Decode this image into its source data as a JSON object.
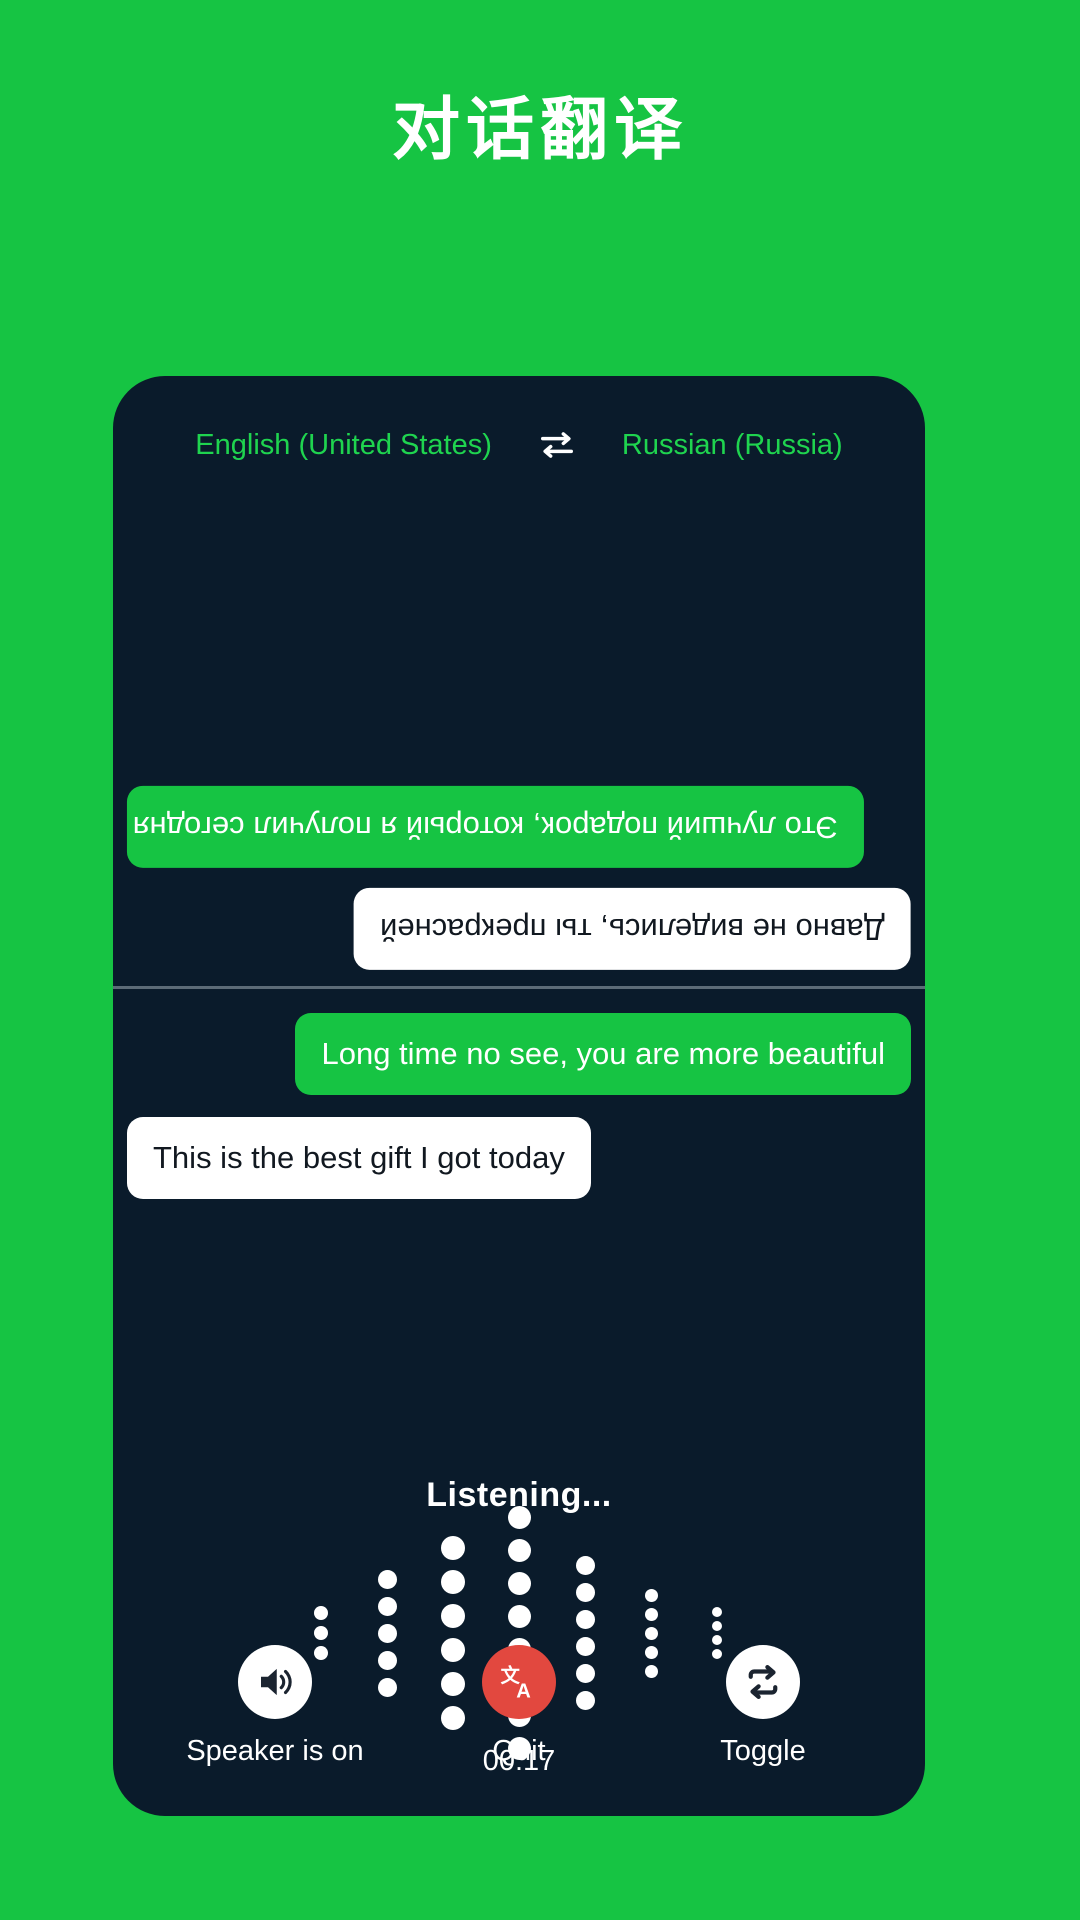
{
  "header": {
    "title": "对话翻译"
  },
  "colors": {
    "brand_green": "#16C443",
    "panel_dark": "#0A1B2B",
    "accent_green_text": "#1FD44F",
    "quit_red": "#E2483F",
    "bubble_white": "#FFFFFF",
    "divider": "#5C6B77"
  },
  "language_bar": {
    "source_language": "English (United States)",
    "swap_icon": "swap-horizontal-icon",
    "target_language": "Russian (Russia)"
  },
  "conversation": {
    "top_panel": {
      "orientation": "rotated-180",
      "messages": [
        {
          "text": "Это лучший подарок, который я получил сегодня",
          "style": "green",
          "align": "left"
        },
        {
          "text": "Давно не виделись, ты прекрасней",
          "style": "white",
          "align": "right"
        }
      ]
    },
    "bottom_panel": {
      "orientation": "normal",
      "messages": [
        {
          "text": "Long time no see, you are more beautiful",
          "style": "green",
          "align": "right"
        },
        {
          "text": "This is the best gift I got today",
          "style": "white",
          "align": "left"
        }
      ]
    }
  },
  "listening": {
    "status_text": "Listening...",
    "timer": "00:17",
    "waveform": {
      "columns": [
        {
          "dots": 3,
          "size": 14
        },
        {
          "dots": 5,
          "size": 19
        },
        {
          "dots": 6,
          "size": 24
        },
        {
          "dots": 8,
          "size": 23
        },
        {
          "dots": 6,
          "size": 19
        },
        {
          "dots": 5,
          "size": 13
        },
        {
          "dots": 4,
          "size": 10
        }
      ]
    }
  },
  "controls": [
    {
      "label": "Speaker is on",
      "icon": "speaker-on-icon",
      "circle": "white"
    },
    {
      "label": "Quit",
      "icon": "translate-icon",
      "circle": "red"
    },
    {
      "label": "Toggle",
      "icon": "repeat-swap-icon",
      "circle": "white"
    }
  ]
}
